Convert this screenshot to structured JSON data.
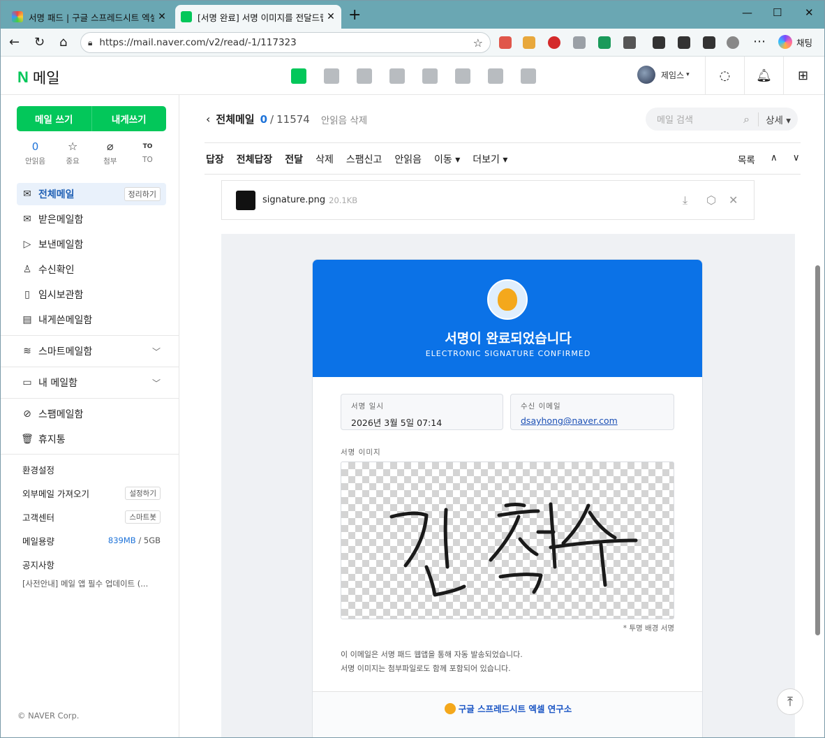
{
  "browser": {
    "tabs": [
      {
        "title": "서명 패드 | 구글 스프레드시트 엑셀",
        "active": false
      },
      {
        "title": "[서명 완료] 서명 이미지를 전달드립니다",
        "active": true
      }
    ],
    "url": "https://mail.naver.com/v2/read/-1/117323",
    "chat_label": "채팅"
  },
  "header": {
    "logo_n": "N",
    "logo_text": "메일",
    "profile_name": "제임스",
    "profile_caret": "▾"
  },
  "sidebar": {
    "compose": "메일 쓰기",
    "compose_self": "내게쓰기",
    "quick": [
      {
        "value": "0",
        "label": "안읽음"
      },
      {
        "icon": "☆",
        "label": "중요"
      },
      {
        "icon": "⌀",
        "label": "첨부"
      },
      {
        "icon": "TO",
        "label": "TO"
      }
    ],
    "folders": [
      {
        "icon": "✉",
        "label": "전체메일",
        "button": "정리하기"
      },
      {
        "icon": "✉",
        "label": "받은메일함"
      },
      {
        "icon": "▷",
        "label": "보낸메일함"
      },
      {
        "icon": "♙",
        "label": "수신확인"
      },
      {
        "icon": "▯",
        "label": "임시보관함"
      },
      {
        "icon": "▤",
        "label": "내게쓴메일함"
      }
    ],
    "smart": "스마트메일함",
    "my": "내 메일함",
    "spam": "스팸메일함",
    "trash": "휴지통",
    "settings": "환경설정",
    "import": "외부메일 가져오기",
    "import_btn": "설정하기",
    "support": "고객센터",
    "support_btn": "스마트봇",
    "capacity": "메일용량",
    "capacity_used": "839MB",
    "capacity_total": " / 5GB",
    "notice_title": "공지사항",
    "notice": "[사전안내] 메일 앱 필수 업데이트 (...",
    "copyright": "© NAVER Corp."
  },
  "main": {
    "back": "‹",
    "title": "전체메일",
    "unread": "0",
    "slash": "/",
    "total": "11574",
    "delete_unread": "안읽음 삭제",
    "search_placeholder": "메일 검색",
    "search_detail": "상세 ▾",
    "toolbar": [
      "답장",
      "전체답장",
      "전달",
      "삭제",
      "스팸신고",
      "안읽음",
      "이동 ▾",
      "더보기 ▾"
    ],
    "list": "목록",
    "up": "∧",
    "down": "∨",
    "attachment": {
      "name": "signature.png",
      "size": "20.1KB"
    }
  },
  "email": {
    "title": "서명이 완료되었습니다",
    "subtitle": "ELECTRONIC SIGNATURE CONFIRMED",
    "date_label": "서명 일시",
    "date_value": "2026년 3월 5일 07:14",
    "email_label": "수신 이메일",
    "email_value": "dsayhong@naver.com",
    "sig_label": "서명 이미지",
    "sig_note": "* 투명 배경 서명",
    "footer1": "이 이메일은 서명 패드 웹앱을 통해 자동 발송되었습니다.",
    "footer2": "서명 이미지는 첨부파일로도 함께 포함되어 있습니다.",
    "brand": "구글 스프레드시트 엑셀 연구소"
  }
}
